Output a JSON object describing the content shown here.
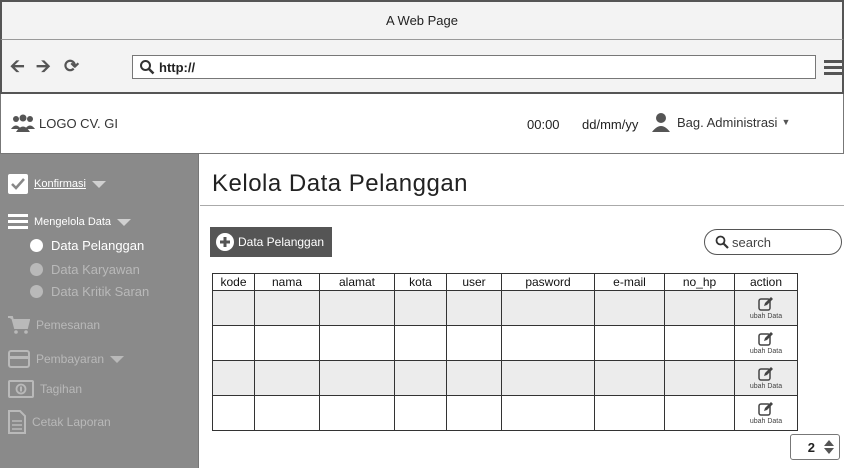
{
  "window": {
    "title": "A Web Page"
  },
  "browser": {
    "url": "http://"
  },
  "header": {
    "logo_text": "LOGO CV. GI",
    "time": "00:00",
    "date": "dd/mm/yy",
    "user_label": "Bag. Administrasi"
  },
  "sidebar": {
    "konfirmasi": "Konfirmasi",
    "mengelola": "Mengelola Data",
    "sub": [
      "Data Pelanggan",
      "Data Karyawan",
      "Data Kritik Saran"
    ],
    "pemesanan": "Pemesanan",
    "pembayaran": "Pembayaran",
    "tagihan": "Tagihan",
    "cetak": "Cetak Laporan"
  },
  "main": {
    "title": "Kelola Data Pelanggan",
    "add_button": "Data Pelanggan",
    "search_placeholder": "search",
    "columns": [
      "kode",
      "nama",
      "alamat",
      "kota",
      "user",
      "pasword",
      "e-mail",
      "no_hp",
      "action"
    ],
    "action_label": "ubah Data",
    "page_number": "2"
  }
}
